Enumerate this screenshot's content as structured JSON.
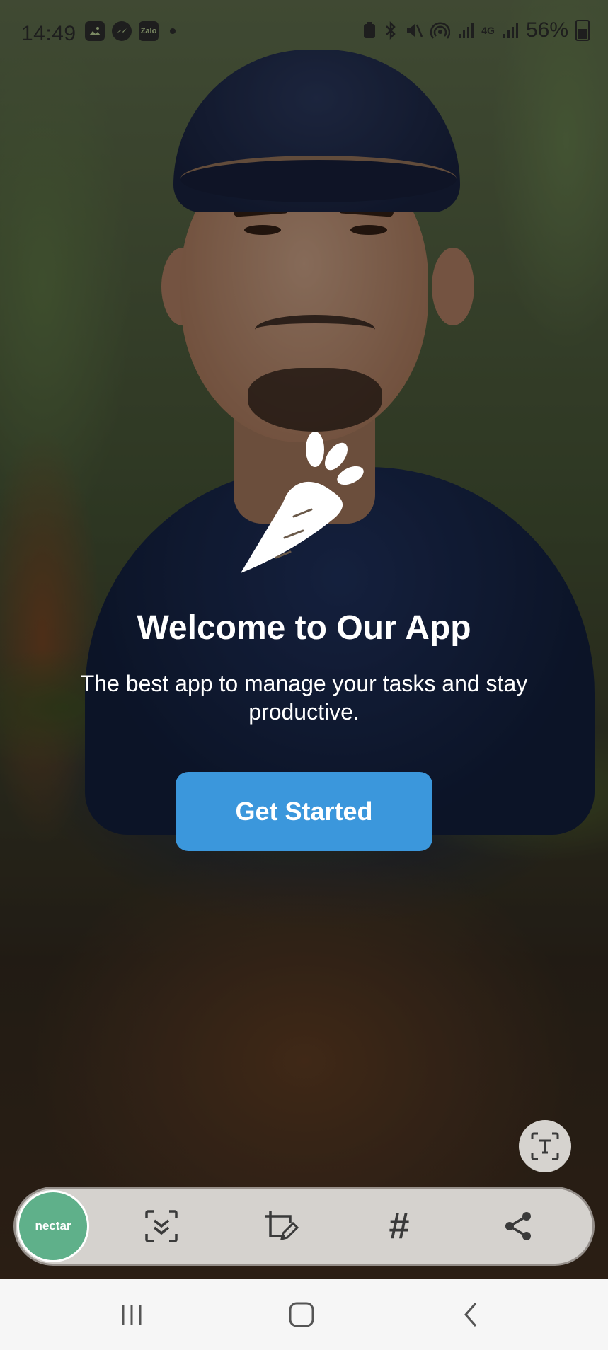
{
  "status_bar": {
    "time": "14:49",
    "left_icons": [
      "gallery-icon",
      "messenger-icon",
      "zalo-icon",
      "dot-icon"
    ],
    "zalo_label": "Zalo",
    "right_icons": [
      "battery-saver-icon",
      "bluetooth-icon",
      "mute-icon",
      "hotspot-icon",
      "signal-icon",
      "data-4g-icon",
      "signal-icon"
    ],
    "network_label": "4G",
    "battery": "56%"
  },
  "welcome": {
    "logo": "carrot-logo",
    "title": "Welcome to Our App",
    "subtitle": "The best app to manage your tasks and stay productive.",
    "button_label": "Get Started",
    "button_color": "#3b97dc"
  },
  "text_extract": {
    "icon": "text-extract-icon"
  },
  "screenshot_toolbar": {
    "thumbnail_label": "nectar",
    "thumbnail_color": "#5fb08a",
    "tools": [
      "scroll-capture-icon",
      "crop-edit-icon",
      "hashtag-icon",
      "share-icon"
    ],
    "hash_symbol": "#"
  },
  "nav_bar": {
    "buttons": [
      "recents-icon",
      "home-icon",
      "back-icon"
    ]
  }
}
